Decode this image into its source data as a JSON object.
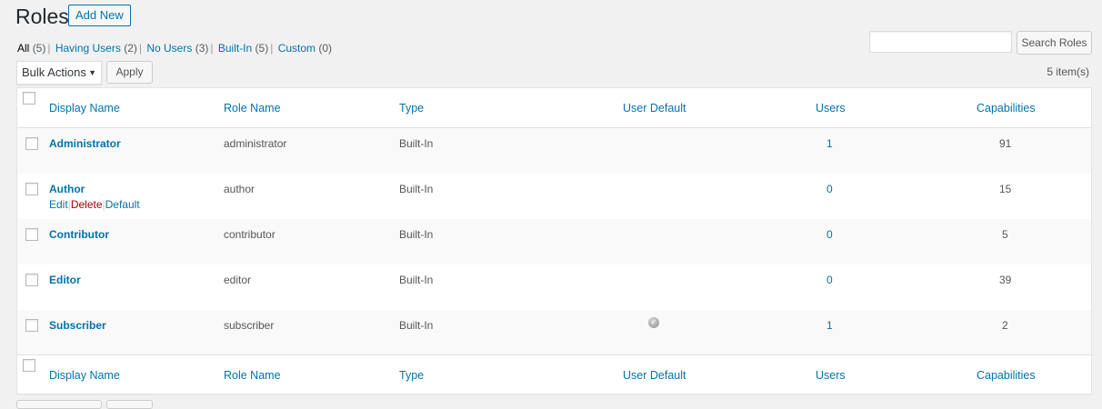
{
  "page": {
    "title": "Roles",
    "add_new_label": "Add New"
  },
  "filters": [
    {
      "label": "All",
      "count": "(5)",
      "current": true
    },
    {
      "label": "Having Users",
      "count": "(2)",
      "current": false
    },
    {
      "label": "No Users",
      "count": "(3)",
      "current": false
    },
    {
      "label": "Built-In",
      "count": "(5)",
      "current": false
    },
    {
      "label": "Custom",
      "count": "(0)",
      "current": false
    }
  ],
  "search": {
    "value": "",
    "placeholder": "",
    "button_label": "Search Roles"
  },
  "bulk": {
    "selected": "Bulk Actions",
    "apply_label": "Apply"
  },
  "items_count": "5 item(s)",
  "table": {
    "columns": [
      "Display Name",
      "Role Name",
      "Type",
      "User Default",
      "Users",
      "Capabilities"
    ],
    "row_actions": {
      "edit": "Edit",
      "delete": "Delete",
      "default": "Default"
    },
    "rows": [
      {
        "display_name": "Administrator",
        "role_name": "administrator",
        "type": "Built-In",
        "user_default": false,
        "users": "1",
        "capabilities": "91"
      },
      {
        "display_name": "Author",
        "role_name": "author",
        "type": "Built-In",
        "user_default": false,
        "users": "0",
        "capabilities": "15"
      },
      {
        "display_name": "Contributor",
        "role_name": "contributor",
        "type": "Built-In",
        "user_default": false,
        "users": "0",
        "capabilities": "5"
      },
      {
        "display_name": "Editor",
        "role_name": "editor",
        "type": "Built-In",
        "user_default": false,
        "users": "0",
        "capabilities": "39"
      },
      {
        "display_name": "Subscriber",
        "role_name": "subscriber",
        "type": "Built-In",
        "user_default": true,
        "users": "1",
        "capabilities": "2"
      }
    ]
  },
  "icons": {
    "default_marker": "check-circle-icon",
    "dropdown": "caret-down-icon"
  },
  "colors": {
    "link": "#0073aa",
    "delete": "#aa0000",
    "background": "#f1f1f1"
  }
}
